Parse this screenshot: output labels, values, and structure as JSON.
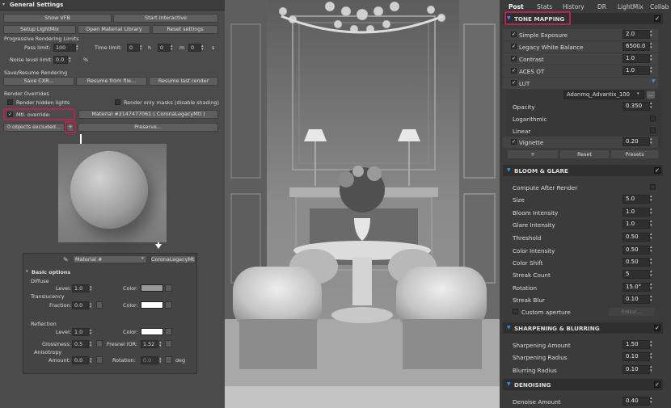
{
  "left": {
    "header": "General Settings",
    "buttons": {
      "show_vfb": "Show VFB",
      "start_interactive": "Start interactive",
      "setup_lightmix": "Setup LightMix",
      "open_material_library": "Open Material Library",
      "reset_settings": "Reset settings"
    },
    "progressive": {
      "title": "Progressive Rendering Limits",
      "pass_limit_label": "Pass limit:",
      "pass_limit": "100",
      "time_limit_label": "Time limit:",
      "h_val": "0",
      "h": "h",
      "m_val": "0",
      "m": "m",
      "s_val": "0",
      "s": "s",
      "noise_label": "Noise level limit:",
      "noise_val": "0.0",
      "pct": "%"
    },
    "save": {
      "title": "Save/Resume Rendering",
      "save_cxr": "Save CXR...",
      "resume_from_file": "Resume from file...",
      "resume_last": "Resume last render"
    },
    "overrides": {
      "title": "Render Overrides",
      "render_hidden_lights": "Render hidden lights",
      "render_only_masks": "Render only masks (disable shading)",
      "mtl_override": "Mtl. override:",
      "material_btn": "Material #2147477061  ( CoronaLegacyMtl )",
      "objects_excluded": "0 objects excluded...",
      "plus": "+",
      "preserve": "Preserve..."
    },
    "mat_editor": {
      "material_name": "Material #",
      "material_type": "CoronaLegacyMtl",
      "basic_options": "Basic options",
      "diffuse": "Diffuse",
      "level_label": "Level:",
      "diffuse_level": "1.0",
      "color_label": "Color:",
      "translucency": "Translucency",
      "fraction_label": "Fraction:",
      "fraction_val": "0.0",
      "reflection": "Reflection",
      "refl_level": "1.0",
      "glossiness_label": "Glossiness:",
      "glossiness_val": "0.5",
      "fresnel_label": "Fresnel IOR:",
      "fresnel_val": "1.52",
      "anisotropy": "Anisotropy",
      "amount_label": "Amount:",
      "amount_val": "0.0",
      "rotation_label": "Rotation:",
      "rotation_val": "0.0",
      "deg": "deg"
    }
  },
  "right": {
    "tabs": [
      "Post",
      "Stats",
      "History",
      "DR",
      "LightMix",
      "Collab"
    ],
    "tone_mapping": {
      "title": "TONE MAPPING",
      "rows": [
        {
          "label": "Simple Exposure",
          "value": "2.0"
        },
        {
          "label": "Legacy White Balance",
          "value": "6500.0"
        },
        {
          "label": "Contrast",
          "value": "1.0"
        },
        {
          "label": "ACES OT",
          "value": "1.0"
        },
        {
          "label": "LUT",
          "value": ""
        }
      ],
      "lut_name": "Adanmq_Advantix_100",
      "lut_more": "...",
      "opacity_label": "Opacity",
      "opacity_val": "0.350",
      "logarithmic": "Logarithmic",
      "linear": "Linear",
      "vignette_label": "Vignette",
      "vignette_val": "0.20",
      "plus": "+",
      "reset": "Reset",
      "presets": "Presets"
    },
    "bloom": {
      "title": "BLOOM & GLARE",
      "compute_after": "Compute After Render",
      "rows": [
        {
          "label": "Size",
          "value": "5.0"
        },
        {
          "label": "Bloom Intensity",
          "value": "1.0"
        },
        {
          "label": "Glare Intensity",
          "value": "1.0"
        },
        {
          "label": "Threshold",
          "value": "0.50"
        },
        {
          "label": "Color Intensity",
          "value": "0.50"
        },
        {
          "label": "Color Shift",
          "value": "0.50"
        },
        {
          "label": "Streak Count",
          "value": "5"
        },
        {
          "label": "Rotation",
          "value": "15.0°"
        },
        {
          "label": "Streak Blur",
          "value": "0.10"
        }
      ],
      "custom_aperture": "Custom aperture",
      "editor": "Editor..."
    },
    "sharpen": {
      "title": "SHARPENING & BLURRING",
      "rows": [
        {
          "label": "Sharpening Amount",
          "value": "1.50"
        },
        {
          "label": "Sharpening Radius",
          "value": "0.10"
        },
        {
          "label": "Blurring Radius",
          "value": "0.10"
        }
      ]
    },
    "denoise": {
      "title": "DENOISING",
      "rows": [
        {
          "label": "Denoise Amount",
          "value": "0.40"
        }
      ]
    }
  },
  "colors": {
    "accent": "#3a90d8",
    "highlight": "#b02850"
  }
}
